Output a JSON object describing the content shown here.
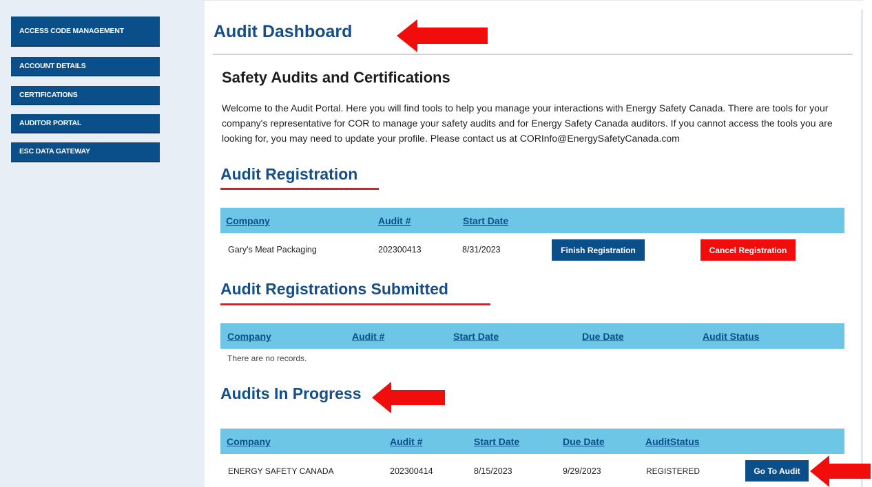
{
  "sidebar": {
    "items": [
      {
        "label": "ACCESS CODE MANAGEMENT"
      },
      {
        "label": "ACCOUNT DETAILS"
      },
      {
        "label": "CERTIFICATIONS"
      },
      {
        "label": "AUDITOR PORTAL"
      },
      {
        "label": "ESC DATA GATEWAY"
      }
    ]
  },
  "page": {
    "title": "Audit Dashboard",
    "section_heading": "Safety Audits and Certifications",
    "intro": "Welcome to the Audit Portal. Here you will find tools to help you manage your interactions with Energy Safety Canada. There are tools for your company's representative for COR to manage your safety audits and for Energy Safety Canada auditors. If you cannot access the tools you are looking for, you may need to update your profile. Please contact us at CORInfo@EnergySafetyCanada.com"
  },
  "registration": {
    "heading": "Audit Registration",
    "columns": [
      "Company",
      "Audit #",
      "Start Date"
    ],
    "rows": [
      {
        "company": "Gary's Meat Packaging",
        "audit": "202300413",
        "start": "8/31/2023"
      }
    ],
    "finish_label": "Finish Registration",
    "cancel_label": "Cancel Registration"
  },
  "submitted": {
    "heading": "Audit Registrations Submitted",
    "columns": [
      "Company",
      "Audit #",
      "Start Date",
      "Due Date",
      "Audit Status"
    ],
    "empty_text": "There are no records."
  },
  "in_progress": {
    "heading": "Audits In Progress",
    "columns": [
      "Company",
      "Audit #",
      "Start Date",
      "Due Date",
      "AuditStatus"
    ],
    "rows": [
      {
        "company": "ENERGY SAFETY CANADA",
        "audit": "202300414",
        "start": "8/15/2023",
        "due": "9/29/2023",
        "status": "REGISTERED"
      }
    ],
    "goto_label": "Go To Audit"
  },
  "colors": {
    "brand_blue": "#0b4f8a",
    "header_cyan": "#6ec6e6",
    "accent_red": "#e51b24"
  }
}
